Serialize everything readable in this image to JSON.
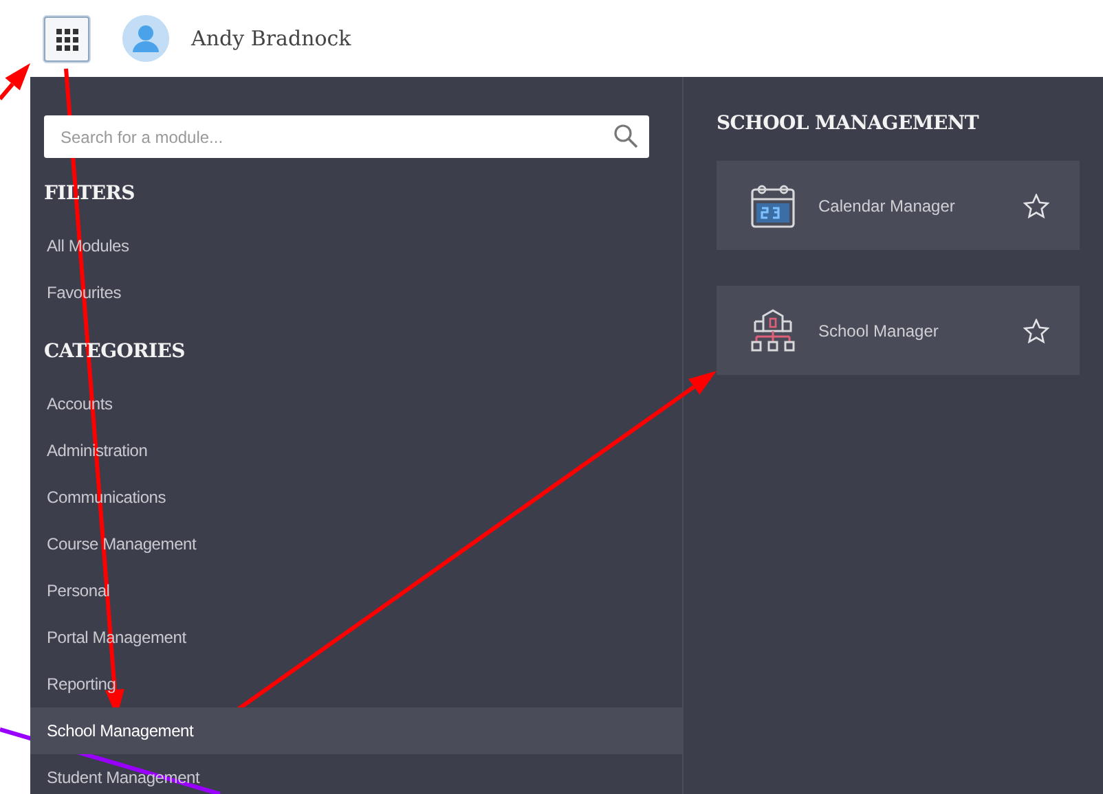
{
  "header": {
    "user_name": "Andy Bradnock",
    "apps_button": {
      "selected": true
    }
  },
  "search": {
    "placeholder": "Search for a module..."
  },
  "filters": {
    "heading": "FILTERS",
    "items": [
      {
        "label": "All Modules",
        "selected": false
      },
      {
        "label": "Favourites",
        "selected": false
      }
    ]
  },
  "categories": {
    "heading": "CATEGORIES",
    "items": [
      {
        "label": "Accounts",
        "selected": false
      },
      {
        "label": "Administration",
        "selected": false
      },
      {
        "label": "Communications",
        "selected": false
      },
      {
        "label": "Course Management",
        "selected": false
      },
      {
        "label": "Personal",
        "selected": false
      },
      {
        "label": "Portal Management",
        "selected": false
      },
      {
        "label": "Reporting",
        "selected": false
      },
      {
        "label": "School Management",
        "selected": true
      },
      {
        "label": "Student Management",
        "selected": false
      }
    ]
  },
  "modules": {
    "heading": "SCHOOL MANAGEMENT",
    "items": [
      {
        "kind": "calendar",
        "label": "Calendar Manager",
        "favourite": false
      },
      {
        "kind": "school",
        "label": "School Manager",
        "favourite": false
      }
    ]
  },
  "annotations": [
    {
      "kind": "arrow",
      "color": "#ff0000"
    },
    {
      "kind": "arrow",
      "color": "#ff0000"
    },
    {
      "kind": "arrow",
      "color": "#ff0000"
    },
    {
      "kind": "line",
      "color": "#9900ff"
    }
  ]
}
